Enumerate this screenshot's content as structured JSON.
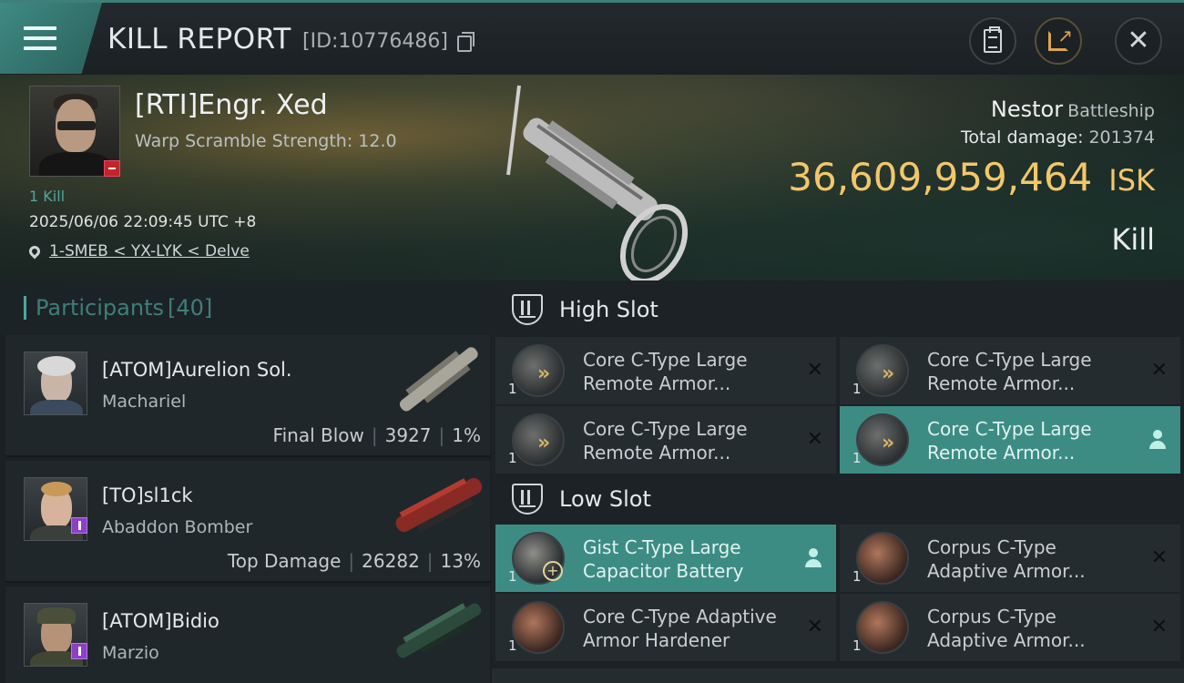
{
  "header": {
    "title": "KILL REPORT",
    "report_id": "[ID:10776486]",
    "icons": {
      "menu": "menu-icon",
      "copy": "copy-icon",
      "clipboard": "clipboard-icon",
      "share": "share-icon",
      "close": "close-icon"
    }
  },
  "victim": {
    "name": "[RTI]Engr. Xed",
    "warp_scramble": "Warp Scramble Strength: 12.0",
    "kills": "1 Kill",
    "datetime": "2025/06/06 22:09:45 UTC +8",
    "location": "1-SMEB < YX-LYK < Delve",
    "ship_name": "Nestor",
    "ship_class": "Battleship",
    "total_damage_label": "Total damage:",
    "total_damage": "201374",
    "isk_value": "36,609,959,464",
    "isk_unit": "ISK",
    "result": "Kill"
  },
  "participants": {
    "title": "Participants",
    "count": "[40]",
    "rows": [
      {
        "name": "[ATOM]Aurelion Sol.",
        "ship": "Machariel",
        "role": "Final Blow",
        "damage": "3927",
        "percent": "1%"
      },
      {
        "name": "[TO]sl1ck",
        "ship": "Abaddon Bomber",
        "role": "Top Damage",
        "damage": "26282",
        "percent": "13%"
      },
      {
        "name": "[ATOM]Bidio",
        "ship": "Marzio",
        "role": "",
        "damage": "",
        "percent": ""
      }
    ]
  },
  "fitting": {
    "high_slot_title": "High Slot",
    "low_slot_title": "Low Slot",
    "high": [
      {
        "line1": "Core C-Type Large",
        "line2": "Remote Armor...",
        "qty": "1",
        "status": "destroyed"
      },
      {
        "line1": "Core C-Type Large",
        "line2": "Remote Armor...",
        "qty": "1",
        "status": "destroyed"
      },
      {
        "line1": "Core C-Type Large",
        "line2": "Remote Armor...",
        "qty": "1",
        "status": "destroyed"
      },
      {
        "line1": "Core C-Type Large",
        "line2": "Remote Armor...",
        "qty": "1",
        "status": "dropped"
      }
    ],
    "low": [
      {
        "line1": "Gist C-Type Large",
        "line2": "Capacitor Battery",
        "qty": "1",
        "status": "dropped"
      },
      {
        "line1": "Corpus C-Type",
        "line2": "Adaptive Armor...",
        "qty": "1",
        "status": "destroyed"
      },
      {
        "line1": "Core C-Type Adaptive",
        "line2": " Armor Hardener",
        "qty": "1",
        "status": "destroyed"
      },
      {
        "line1": "Corpus C-Type",
        "line2": "Adaptive Armor...",
        "qty": "1",
        "status": "destroyed"
      }
    ]
  },
  "colors": {
    "accent": "#3d8c84",
    "isk": "#f2c76b",
    "badge_red": "#c0262a",
    "badge_purple": "#8e3fc7"
  }
}
